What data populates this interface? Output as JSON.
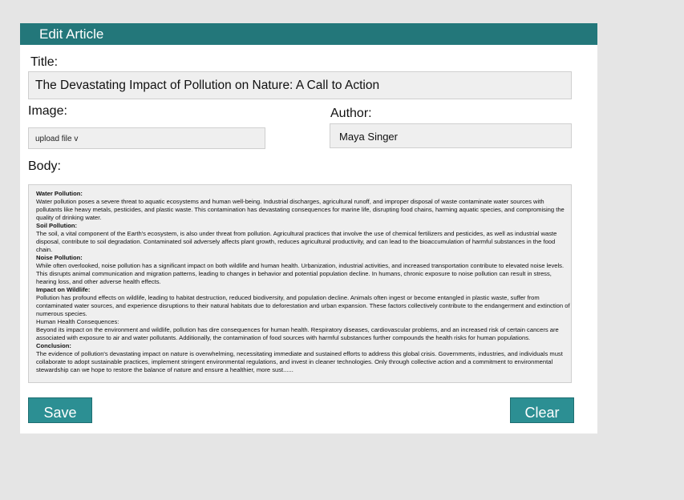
{
  "header": {
    "title": "Edit Article"
  },
  "form": {
    "title_label": "Title:",
    "title_value": "The Devastating Impact of Pollution on Nature: A Call to Action",
    "image_label": "Image:",
    "image_value": "upload file  v",
    "author_label": "Author:",
    "author_value": "Maya Singer",
    "body_label": "Body:"
  },
  "body_sections": [
    {
      "heading": "Water Pollution:",
      "heading_bold": true,
      "text": "Water pollution poses a severe threat to aquatic ecosystems and human well-being. Industrial discharges, agricultural runoff, and improper disposal of waste contaminate water sources with pollutants like heavy metals, pesticides, and plastic waste. This contamination has devastating consequences for marine life, disrupting food chains, harming aquatic species, and compromising the quality of drinking water."
    },
    {
      "heading": "Soil Pollution:",
      "heading_bold": true,
      "text": "The soil, a vital component of the Earth's ecosystem, is also under threat from pollution. Agricultural practices that involve the use of chemical fertilizers and pesticides, as well as industrial waste disposal, contribute to soil degradation. Contaminated soil adversely affects plant growth, reduces agricultural productivity, and can lead to the bioaccumulation of harmful substances in the food chain."
    },
    {
      "heading": "Noise Pollution:",
      "heading_bold": true,
      "text": "While often overlooked, noise pollution has a significant impact on both wildlife and human health. Urbanization, industrial activities, and increased transportation contribute to elevated noise levels. This disrupts animal communication and migration patterns, leading to changes in behavior and potential population decline. In humans, chronic exposure to noise pollution can result in stress, hearing loss, and other adverse health effects."
    },
    {
      "heading": "Impact on Wildlife:",
      "heading_bold": true,
      "text": "Pollution has profound effects on wildlife, leading to habitat destruction, reduced biodiversity, and population decline. Animals often ingest or become entangled in plastic waste, suffer from contaminated water sources, and experience disruptions to their natural habitats due to deforestation and urban expansion. These factors collectively contribute to the endangerment and extinction of numerous species."
    },
    {
      "heading": "Human Health Consequences:",
      "heading_bold": false,
      "text": "Beyond its impact on the environment and wildlife, pollution has dire consequences for human health. Respiratory diseases, cardiovascular problems, and an increased risk of certain cancers are associated with exposure to air and water pollutants. Additionally, the contamination of food sources with harmful substances further compounds the health risks for human populations."
    },
    {
      "heading": "Conclusion:",
      "heading_bold": true,
      "text": "The evidence of pollution's devastating impact on nature is overwhelming, necessitating immediate and sustained efforts to address this global crisis. Governments, industries, and individuals must collaborate to adopt sustainable practices, implement stringent environmental regulations, and invest in cleaner technologies. Only through collective action and a commitment to environmental stewardship can we hope to restore the balance of nature and ensure a healthier, more sust......"
    }
  ],
  "buttons": {
    "save": "Save",
    "clear": "Clear"
  },
  "colors": {
    "header": "#23777a",
    "button": "#2c8f93"
  }
}
